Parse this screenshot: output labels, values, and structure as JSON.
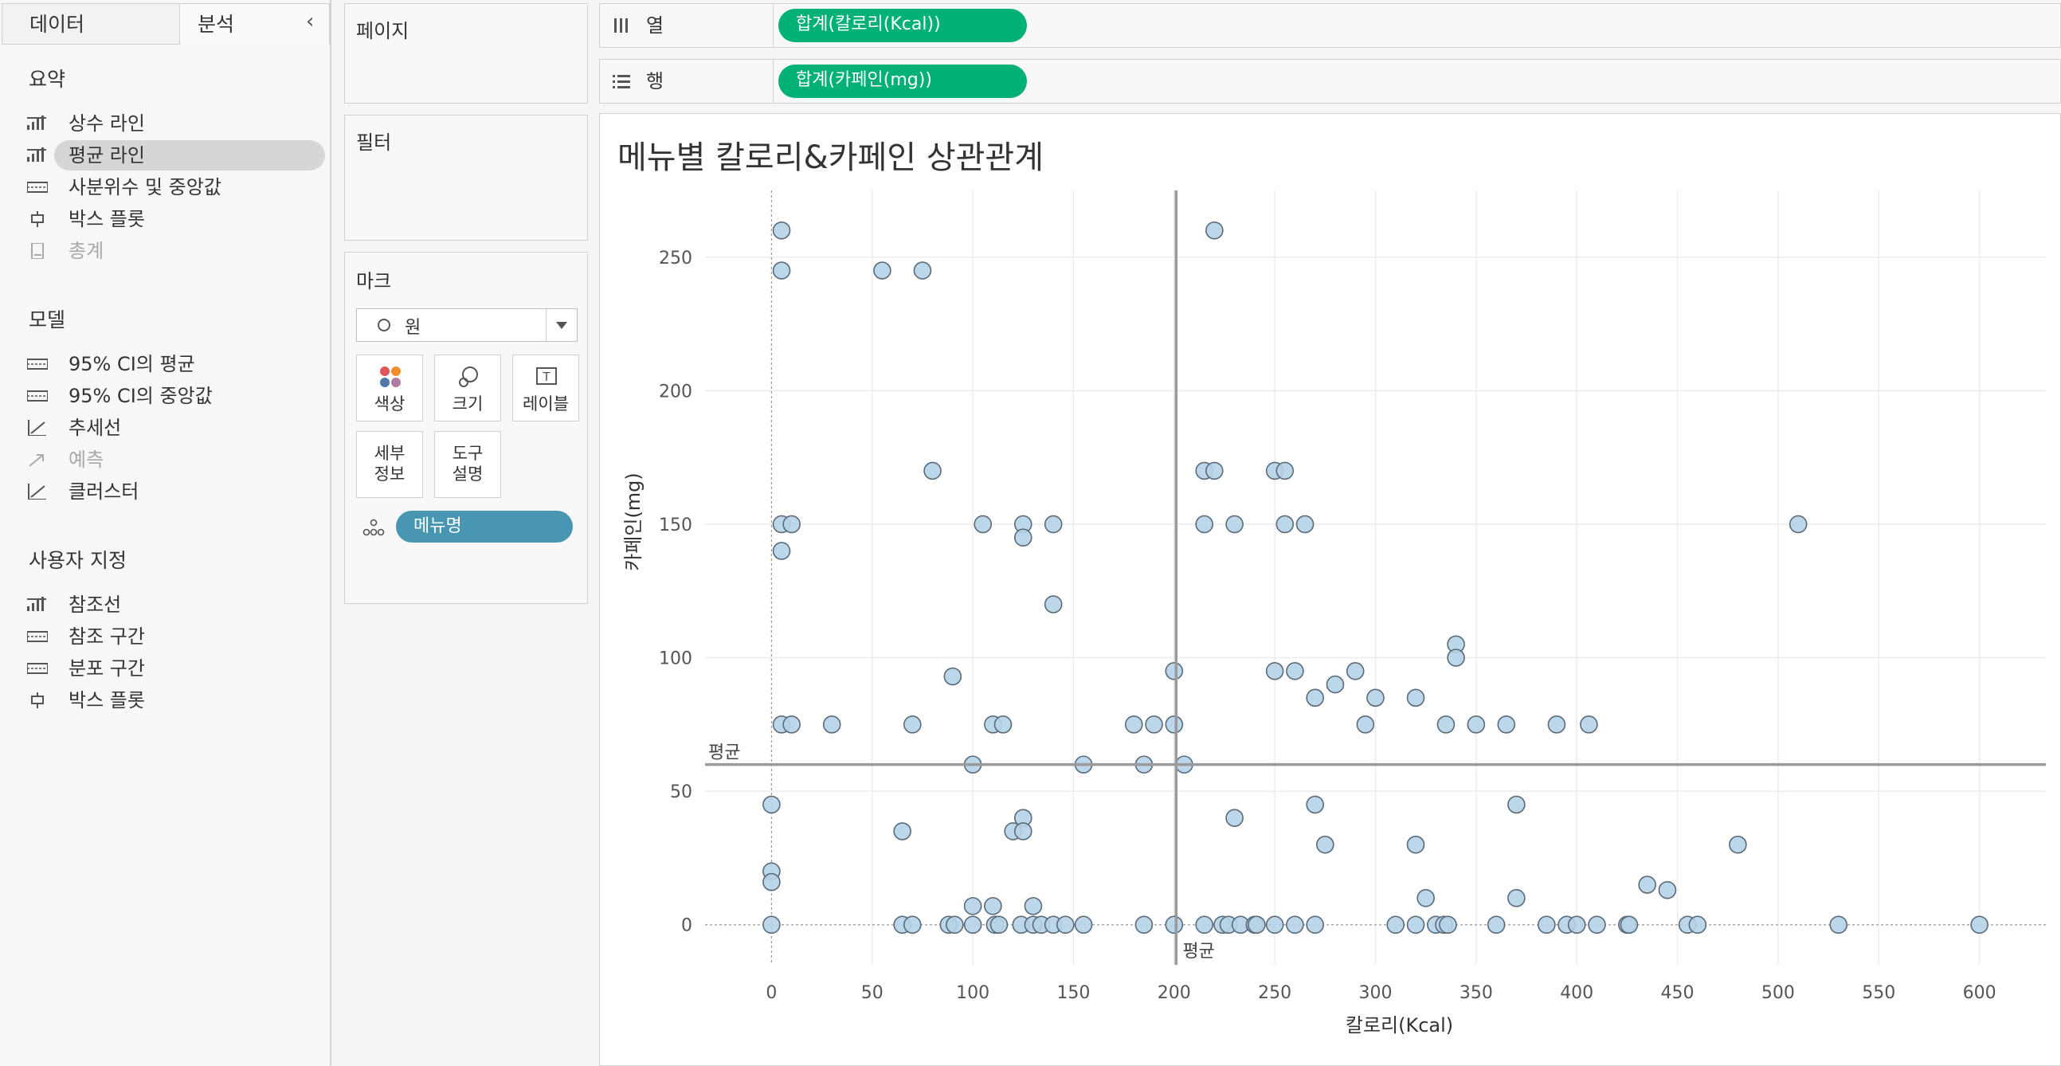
{
  "left_pane": {
    "tabs": [
      "데이터",
      "분석"
    ],
    "sections": [
      {
        "title": "요약",
        "items": [
          {
            "label": "상수 라인",
            "icon": "constant-line-icon",
            "enabled": true
          },
          {
            "label": "평균 라인",
            "icon": "average-line-icon",
            "enabled": true,
            "selected": true
          },
          {
            "label": "사분위수 및 중앙값",
            "icon": "quartile-icon",
            "enabled": true
          },
          {
            "label": "박스 플롯",
            "icon": "box-plot-icon",
            "enabled": true
          },
          {
            "label": "총계",
            "icon": "totals-icon",
            "enabled": false
          }
        ]
      },
      {
        "title": "모델",
        "items": [
          {
            "label": "95% CI의 평균",
            "icon": "ci-mean-icon",
            "enabled": true
          },
          {
            "label": "95% CI의 중앙값",
            "icon": "ci-median-icon",
            "enabled": true
          },
          {
            "label": "추세선",
            "icon": "trend-line-icon",
            "enabled": true
          },
          {
            "label": "예측",
            "icon": "forecast-icon",
            "enabled": false
          },
          {
            "label": "클러스터",
            "icon": "cluster-icon",
            "enabled": true
          }
        ]
      },
      {
        "title": "사용자 지정",
        "items": [
          {
            "label": "참조선",
            "icon": "reference-line-icon",
            "enabled": true
          },
          {
            "label": "참조 구간",
            "icon": "reference-band-icon",
            "enabled": true
          },
          {
            "label": "분포 구간",
            "icon": "distribution-band-icon",
            "enabled": true
          },
          {
            "label": "박스 플롯",
            "icon": "box-plot-icon",
            "enabled": true
          }
        ]
      }
    ]
  },
  "pages_card": {
    "title": "페이지"
  },
  "filters_card": {
    "title": "필터"
  },
  "marks_card": {
    "title": "마크",
    "mark_type": "원",
    "buttons": [
      "색상",
      "크기",
      "레이블",
      "세부\n정보",
      "도구\n설명"
    ],
    "field": "메뉴명"
  },
  "columns_shelf": {
    "label": "열",
    "pill": "합계(칼로리(Kcal))"
  },
  "rows_shelf": {
    "label": "행",
    "pill": "합계(카페인(mg))"
  },
  "colors": {
    "pill_measure": "#00b176",
    "pill_dimension": "#4996b2",
    "mark_fill": "#b5d3e7",
    "mark_stroke": "#5b6a78"
  },
  "chart_data": {
    "type": "scatter",
    "title": "메뉴별 칼로리&카페인 상관관계",
    "xlabel": "칼로리(Kcal)",
    "ylabel": "카페인(mg)",
    "xlim": [
      -33,
      633
    ],
    "ylim": [
      -15,
      275
    ],
    "xticks": [
      0,
      50,
      100,
      150,
      200,
      250,
      300,
      350,
      400,
      450,
      500,
      550,
      600
    ],
    "yticks": [
      0,
      50,
      100,
      150,
      200,
      250
    ],
    "grid": true,
    "reference_lines": [
      {
        "axis": "x",
        "value": 201,
        "label": "평균"
      },
      {
        "axis": "y",
        "value": 60,
        "label": "평균"
      }
    ],
    "points": [
      [
        5,
        260
      ],
      [
        220,
        260
      ],
      [
        5,
        245
      ],
      [
        55,
        245
      ],
      [
        75,
        245
      ],
      [
        80,
        170
      ],
      [
        215,
        170
      ],
      [
        220,
        170
      ],
      [
        250,
        170
      ],
      [
        255,
        170
      ],
      [
        5,
        150
      ],
      [
        10,
        150
      ],
      [
        105,
        150
      ],
      [
        125,
        150
      ],
      [
        140,
        150
      ],
      [
        215,
        150
      ],
      [
        230,
        150
      ],
      [
        255,
        150
      ],
      [
        265,
        150
      ],
      [
        510,
        150
      ],
      [
        125,
        145
      ],
      [
        5,
        140
      ],
      [
        140,
        120
      ],
      [
        340,
        105
      ],
      [
        340,
        100
      ],
      [
        200,
        95
      ],
      [
        250,
        95
      ],
      [
        260,
        95
      ],
      [
        290,
        95
      ],
      [
        90,
        93
      ],
      [
        280,
        90
      ],
      [
        270,
        85
      ],
      [
        300,
        85
      ],
      [
        320,
        85
      ],
      [
        5,
        75
      ],
      [
        10,
        75
      ],
      [
        30,
        75
      ],
      [
        70,
        75
      ],
      [
        110,
        75
      ],
      [
        115,
        75
      ],
      [
        180,
        75
      ],
      [
        190,
        75
      ],
      [
        200,
        75
      ],
      [
        295,
        75
      ],
      [
        335,
        75
      ],
      [
        350,
        75
      ],
      [
        365,
        75
      ],
      [
        390,
        75
      ],
      [
        406,
        75
      ],
      [
        100,
        60
      ],
      [
        155,
        60
      ],
      [
        185,
        60
      ],
      [
        205,
        60
      ],
      [
        0,
        45
      ],
      [
        270,
        45
      ],
      [
        370,
        45
      ],
      [
        230,
        40
      ],
      [
        125,
        40
      ],
      [
        65,
        35
      ],
      [
        120,
        35
      ],
      [
        125,
        35
      ],
      [
        275,
        30
      ],
      [
        320,
        30
      ],
      [
        480,
        30
      ],
      [
        0,
        20
      ],
      [
        0,
        16
      ],
      [
        435,
        15
      ],
      [
        445,
        13
      ],
      [
        325,
        10
      ],
      [
        370,
        10
      ],
      [
        100,
        7
      ],
      [
        110,
        7
      ],
      [
        130,
        7
      ],
      [
        0,
        0
      ],
      [
        65,
        0
      ],
      [
        70,
        0
      ],
      [
        88,
        0
      ],
      [
        91,
        0
      ],
      [
        100,
        0
      ],
      [
        111,
        0
      ],
      [
        113,
        0
      ],
      [
        124,
        0
      ],
      [
        130,
        0
      ],
      [
        134,
        0
      ],
      [
        140,
        0
      ],
      [
        146,
        0
      ],
      [
        155,
        0
      ],
      [
        185,
        0
      ],
      [
        200,
        0
      ],
      [
        215,
        0
      ],
      [
        224,
        0
      ],
      [
        227,
        0
      ],
      [
        233,
        0
      ],
      [
        240,
        0
      ],
      [
        241,
        0
      ],
      [
        250,
        0
      ],
      [
        260,
        0
      ],
      [
        270,
        0
      ],
      [
        310,
        0
      ],
      [
        320,
        0
      ],
      [
        330,
        0
      ],
      [
        334,
        0
      ],
      [
        336,
        0
      ],
      [
        360,
        0
      ],
      [
        385,
        0
      ],
      [
        395,
        0
      ],
      [
        400,
        0
      ],
      [
        410,
        0
      ],
      [
        425,
        0
      ],
      [
        426,
        0
      ],
      [
        455,
        0
      ],
      [
        460,
        0
      ],
      [
        530,
        0
      ],
      [
        600,
        0
      ]
    ]
  }
}
